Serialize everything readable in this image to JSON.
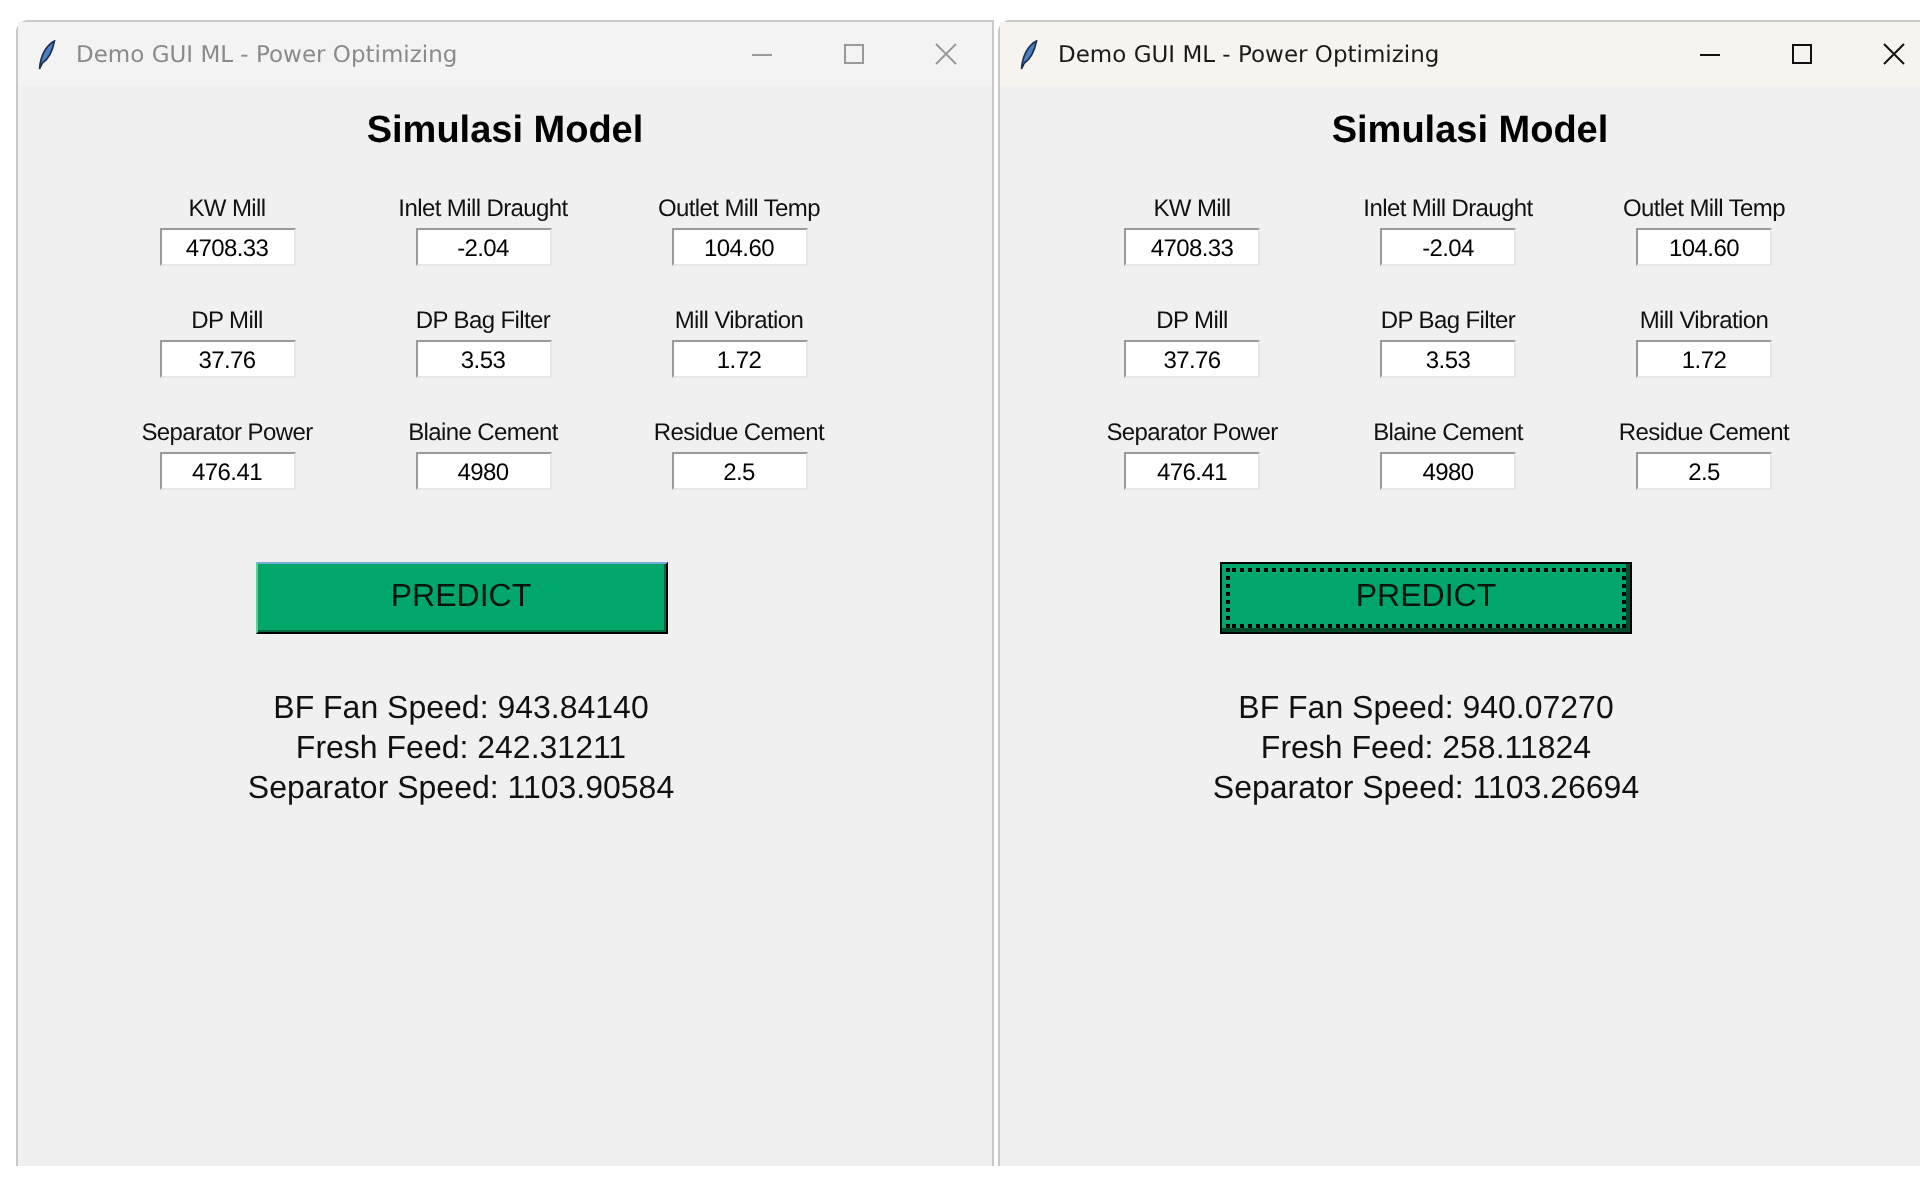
{
  "windows": [
    {
      "title": "Demo GUI ML - Power Optimizing",
      "active": false,
      "heading": "Simulasi Model",
      "fields": [
        {
          "label": "KW Mill",
          "value": "4708.33"
        },
        {
          "label": "Inlet Mill Draught",
          "value": "-2.04"
        },
        {
          "label": "Outlet Mill Temp",
          "value": "104.60"
        },
        {
          "label": "DP Mill",
          "value": "37.76"
        },
        {
          "label": "DP Bag Filter",
          "value": "3.53"
        },
        {
          "label": "Mill Vibration",
          "value": "1.72"
        },
        {
          "label": "Separator Power",
          "value": "476.41"
        },
        {
          "label": "Blaine Cement",
          "value": "4980"
        },
        {
          "label": "Residue Cement",
          "value": "2.5"
        }
      ],
      "button": {
        "label": "PREDICT",
        "focused": false
      },
      "results": [
        "BF Fan Speed: 943.84140",
        "Fresh Feed: 242.31211",
        "Separator Speed: 1103.90584"
      ]
    },
    {
      "title": "Demo GUI ML - Power Optimizing",
      "active": true,
      "heading": "Simulasi Model",
      "fields": [
        {
          "label": "KW Mill",
          "value": "4708.33"
        },
        {
          "label": "Inlet Mill Draught",
          "value": "-2.04"
        },
        {
          "label": "Outlet Mill Temp",
          "value": "104.60"
        },
        {
          "label": "DP Mill",
          "value": "37.76"
        },
        {
          "label": "DP Bag Filter",
          "value": "3.53"
        },
        {
          "label": "Mill Vibration",
          "value": "1.72"
        },
        {
          "label": "Separator Power",
          "value": "476.41"
        },
        {
          "label": "Blaine Cement",
          "value": "4980"
        },
        {
          "label": "Residue Cement",
          "value": "2.5"
        }
      ],
      "button": {
        "label": "PREDICT",
        "focused": true
      },
      "results": [
        "BF Fan Speed: 940.07270",
        "Fresh Feed: 258.11824",
        "Separator Speed: 1103.26694"
      ]
    }
  ]
}
